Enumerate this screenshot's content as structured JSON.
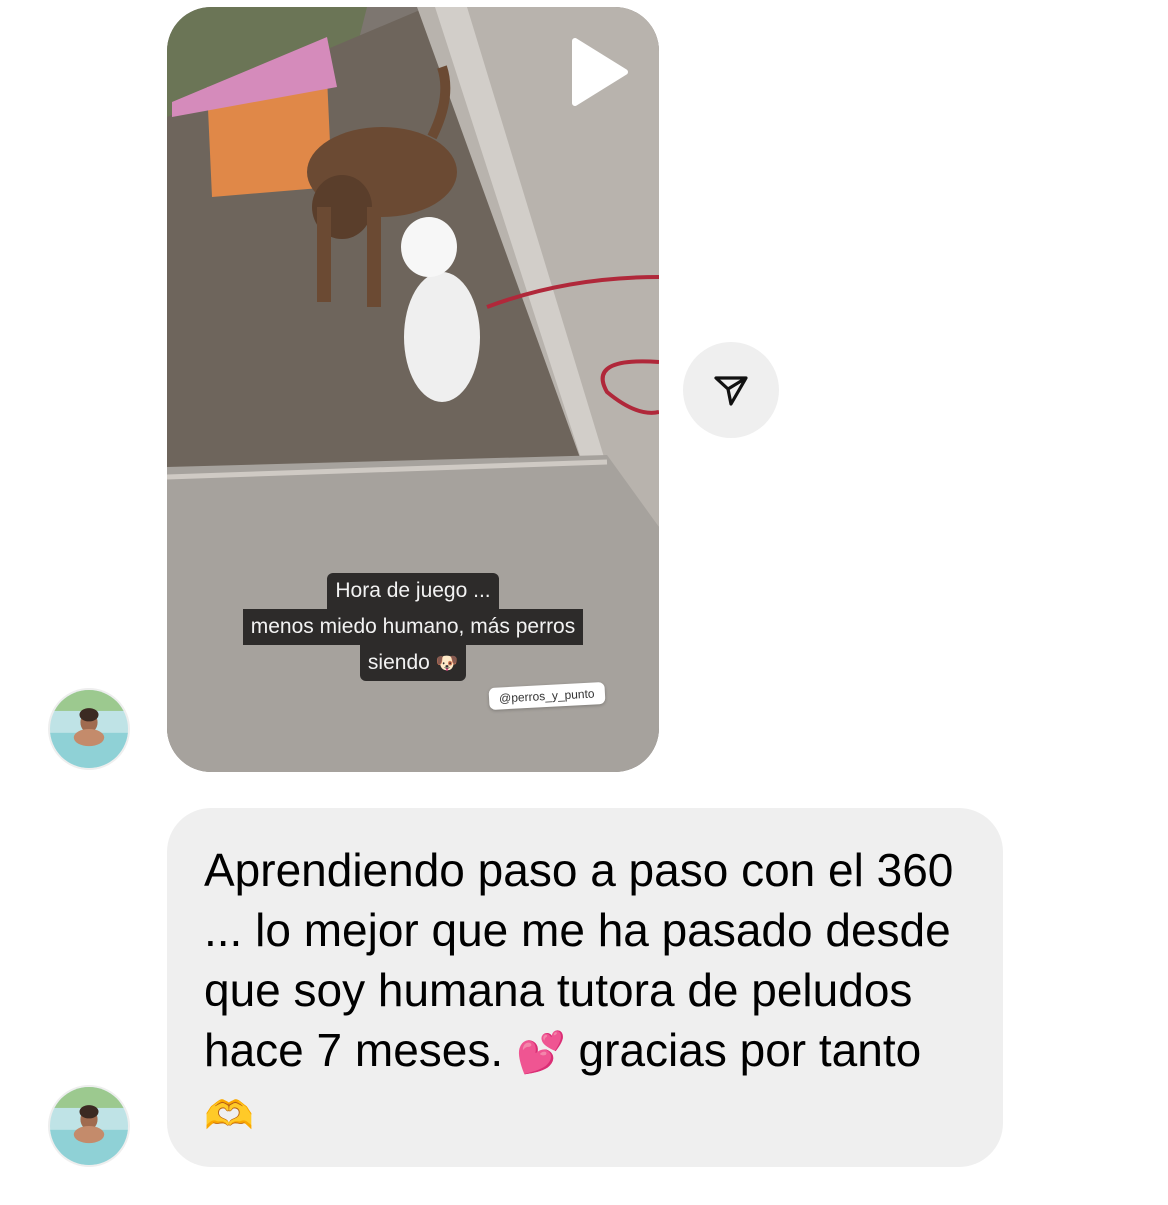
{
  "story": {
    "caption_lines": [
      "Hora de juego ...",
      "menos miedo humano, más perros",
      "siendo"
    ],
    "caption_emoji": "dog-face",
    "mention": "@perros_y_punto",
    "icons": {
      "play": "play-icon",
      "share": "paper-plane-icon"
    }
  },
  "message": {
    "text": "Aprendiendo paso a paso con el 360 ... lo mejor que me ha pasado desde que soy humana tutora de peludos hace 7 meses. 💕 gracias por tanto 🫶",
    "text_before_heart": "Aprendiendo paso a paso con el 360 ... lo mejor que me ha pasado desde que soy humana tutora de peludos hace 7 meses.",
    "heart": "💕",
    "text_after_heart": "gracias por tanto",
    "hands": "🫶"
  },
  "colors": {
    "bubble_bg": "#efefef",
    "share_bg": "#efefef",
    "caption_bg": "#2d2b2a"
  }
}
